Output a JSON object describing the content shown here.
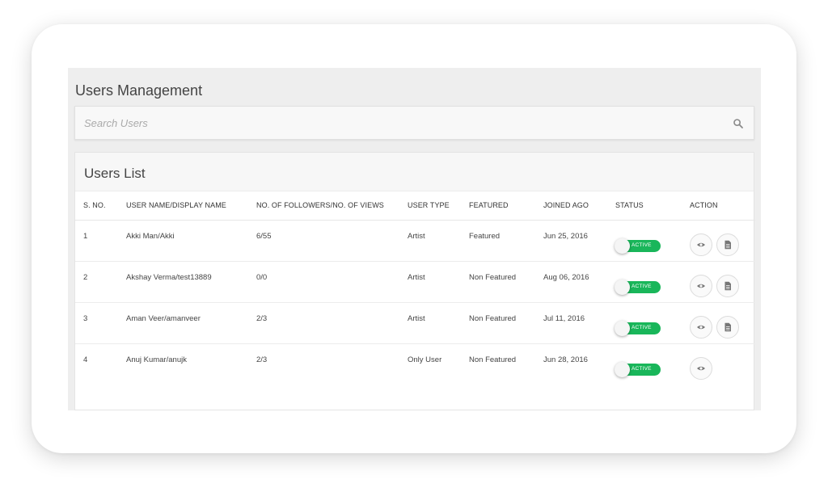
{
  "page": {
    "title": "Users Management"
  },
  "search": {
    "placeholder": "Search Users",
    "icon": "search-icon"
  },
  "panel": {
    "title": "Users List"
  },
  "columns": [
    "S. NO.",
    "USER NAME/DISPLAY NAME",
    "NO. OF FOLLOWERS/NO. OF VIEWS",
    "USER TYPE",
    "FEATURED",
    "JOINED AGO",
    "STATUS",
    "ACTION"
  ],
  "rows": [
    {
      "sno": "1",
      "name": "Akki Man/Akki",
      "followers": "6/55",
      "type": "Artist",
      "featured": "Featured",
      "joined": "Jun 25, 2016",
      "status": "ACTIVE",
      "actions": [
        "view",
        "document"
      ]
    },
    {
      "sno": "2",
      "name": "Akshay Verma/test13889",
      "followers": "0/0",
      "type": "Artist",
      "featured": "Non Featured",
      "joined": "Aug 06, 2016",
      "status": "ACTIVE",
      "actions": [
        "view",
        "document"
      ]
    },
    {
      "sno": "3",
      "name": "Aman Veer/amanveer",
      "followers": "2/3",
      "type": "Artist",
      "featured": "Non Featured",
      "joined": "Jul 11, 2016",
      "status": "ACTIVE",
      "actions": [
        "view",
        "document"
      ]
    },
    {
      "sno": "4",
      "name": "Anuj Kumar/anujk",
      "followers": "2/3",
      "type": "Only User",
      "featured": "Non Featured",
      "joined": "Jun 28, 2016",
      "status": "ACTIVE",
      "actions": [
        "view"
      ]
    }
  ],
  "colors": {
    "active": "#19b65a",
    "background": "#eeeeee",
    "panel": "#ffffff"
  }
}
